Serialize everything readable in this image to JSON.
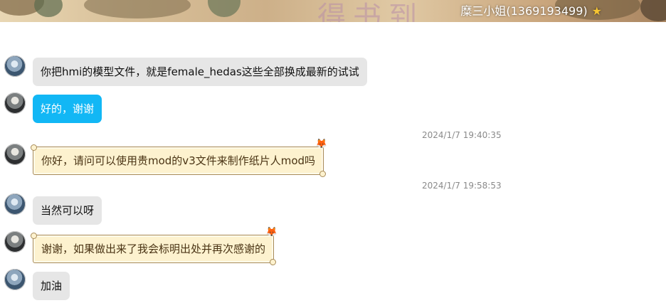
{
  "header": {
    "contact_name": "糜三小姐(1369193499)",
    "badge_icon": "star-icon",
    "banner_deco_text": "得书到"
  },
  "messages": [
    {
      "sender": "me",
      "avatar_icon": "anime-avatar-icon",
      "style": "gray",
      "text": "你把hmi的模型文件，就是female_hedas这些全部换成最新的试试"
    },
    {
      "sender": "contact",
      "avatar_icon": "contact-avatar-icon",
      "style": "blue",
      "text": "好的，谢谢"
    },
    {
      "timestamp": "2024/1/7 19:40:35"
    },
    {
      "sender": "contact",
      "avatar_icon": "contact-avatar-icon",
      "style": "scroll",
      "decoration_icon": "fox-icon",
      "text": "你好，请问可以使用贵mod的v3文件来制作纸片人mod吗"
    },
    {
      "timestamp": "2024/1/7 19:58:53"
    },
    {
      "sender": "me",
      "avatar_icon": "anime-avatar-icon",
      "style": "gray",
      "text": "当然可以呀"
    },
    {
      "sender": "contact",
      "avatar_icon": "contact-avatar-icon",
      "style": "scroll",
      "decoration_icon": "fox-icon",
      "text": "谢谢，如果做出来了我会标明出处并再次感谢的"
    },
    {
      "sender": "me",
      "avatar_icon": "anime-avatar-icon",
      "style": "gray",
      "text": "加油"
    }
  ],
  "colors": {
    "bubble_gray": "#e6e6e6",
    "bubble_blue": "#12b7f5",
    "bubble_scroll": "#fdf2cf",
    "timestamp": "#8a8a8a"
  }
}
